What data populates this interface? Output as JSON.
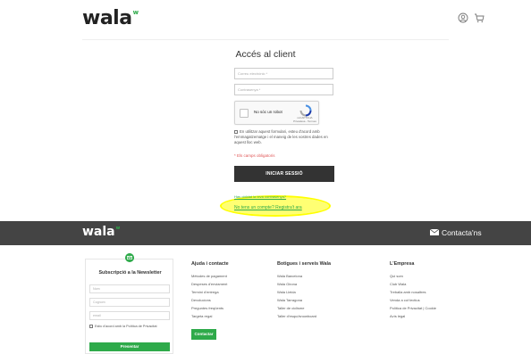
{
  "header": {
    "logo": "wala",
    "logo_sup": "w"
  },
  "login": {
    "title": "Accés al client",
    "email_placeholder": "Correu electrònic *",
    "password_placeholder": "Contrasenya *",
    "captcha_label": "No sóc un robot",
    "captcha_brand": "reCAPTCHA",
    "captcha_terms": "Privadesa - Termes",
    "consent_text": "En utilitzar aquest formulari, esteu d'acord amb l'emmagatzematge i el maneig de les vostres dades en aquest lloc web.",
    "required_note": "* Els camps obligatoris",
    "submit_label": "INICIAR SESSIÓ",
    "forgot_link": "Has oblidat la teva contrasenya?",
    "register_link": "No tens un compte? Registra't ara"
  },
  "footer": {
    "logo": "wala",
    "logo_sup": "w",
    "contact_label": "Contacta'ns",
    "newsletter": {
      "title": "Subscripció a la Newsletter",
      "name_placeholder": "Nom",
      "surname_placeholder": "Cognom",
      "email_placeholder": "email",
      "consent": "Estic d'acord amb la Política de Privacitat",
      "button": "Presentar"
    },
    "columns": [
      {
        "title": "Ajuda i contacte",
        "items": [
          "Mètodes de pagament",
          "Despeses d'enviament",
          "Termini d'entrega",
          "Devolucions",
          "Preguntes freqüents",
          "Targeta regal"
        ]
      },
      {
        "title": "Botigues i serveis Wala",
        "items": [
          "Wala Barcelona",
          "Wala Girona",
          "Wala Lleida",
          "Wala Tarragona",
          "Taller de ciclisme",
          "Taller d'esquí/snowboard"
        ]
      },
      {
        "title": "L'Empresa",
        "items": [
          "Qui som",
          "Club Wala",
          "Treballa amb nosaltres",
          "Venda a col·lectius",
          "Política de Privacitat | Cookie",
          "Avís legal"
        ]
      }
    ],
    "contact_button": "Contactar"
  },
  "colors": {
    "brand_green": "#2eaa4a",
    "footer_bg": "#444444",
    "button_dark": "#333333",
    "highlight": "#ffff00"
  }
}
